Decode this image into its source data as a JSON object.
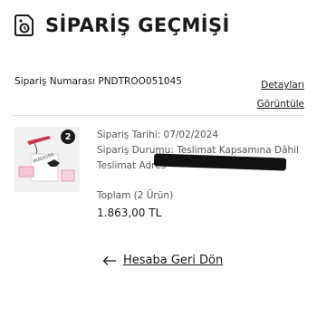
{
  "header": {
    "title": "SİPARİŞ GEÇMİŞİ",
    "icon": "receipt-icon"
  },
  "order": {
    "number_text": "Sipariş Numarası PNDTROO051045",
    "details_link": "Detayları Görüntüle",
    "quantity_badge": "2",
    "date_text": "Sipariş Tarihi: 07/02/2024",
    "status_text": "Sipariş Durumu: Teslimat Kapsamına Dâhil",
    "address_label": "Teslimat Adres",
    "total_label": "Toplam (2 Ürün)",
    "price": "1.863,00 TL"
  },
  "footer": {
    "back_label": "Hesaba Geri Dön",
    "icon": "arrow-left-icon"
  },
  "colors": {
    "text": "#1a1a1a",
    "muted": "#555555",
    "divider": "#e2e2e2",
    "redaction": "#111111"
  }
}
